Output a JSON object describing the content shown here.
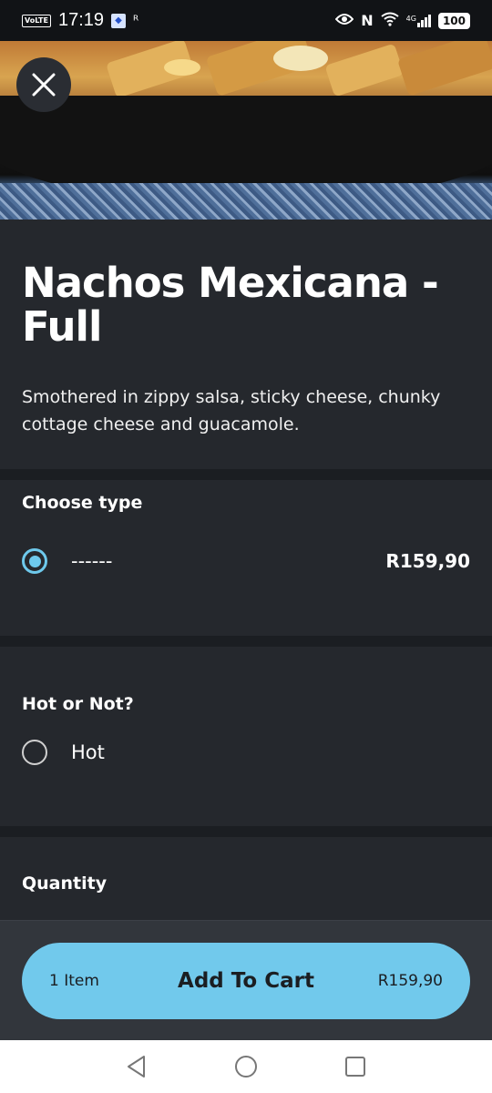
{
  "status_bar": {
    "volte": "VoLTE",
    "time": "17:19",
    "network": "4G",
    "battery": "100"
  },
  "product": {
    "title": "Nachos Mexicana - Full",
    "description": "Smothered in zippy salsa, sticky cheese, chunky cottage cheese and guacamole."
  },
  "sections": {
    "type": {
      "title": "Choose type",
      "options": [
        {
          "label": "------",
          "price": "R159,90",
          "selected": true
        }
      ]
    },
    "hot": {
      "title": "Hot or Not?",
      "options": [
        {
          "label": "Hot",
          "selected": false
        }
      ]
    },
    "quantity": {
      "title": "Quantity"
    }
  },
  "cart_button": {
    "count": "1 Item",
    "label": "Add To Cart",
    "total": "R159,90"
  },
  "icons": {
    "close": "close-icon",
    "back": "back-triangle-icon",
    "home": "home-circle-icon",
    "recents": "recents-square-icon"
  },
  "colors": {
    "accent": "#71c9ec",
    "card": "#25282d",
    "background": "#1b1e22"
  }
}
